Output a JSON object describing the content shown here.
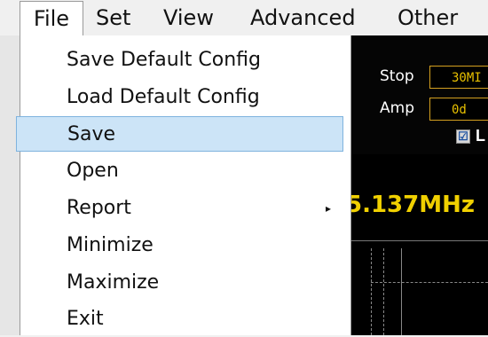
{
  "menubar": {
    "items": [
      "File",
      "Set",
      "View",
      "Advanced",
      "Other"
    ]
  },
  "file_menu": {
    "items": [
      {
        "label": "Save Default Config"
      },
      {
        "label": "Load Default Config"
      },
      {
        "label": "Save",
        "highlighted": true
      },
      {
        "label": "Open"
      },
      {
        "label": "Report",
        "has_submenu": true
      },
      {
        "label": "Minimize"
      },
      {
        "label": "Maximize"
      },
      {
        "label": "Exit"
      }
    ],
    "submenu_arrow": "▸"
  },
  "controls": {
    "stop_label": "Stop",
    "stop_value": "30MI",
    "amp_label": "Amp",
    "amp_value": "0d",
    "l_check": "☑",
    "l_label": "L"
  },
  "readout": {
    "frequency": "5.137MHz"
  },
  "colors": {
    "highlight": "#cce4f7",
    "readout": "#f0d000",
    "box_border": "#d4a020"
  }
}
